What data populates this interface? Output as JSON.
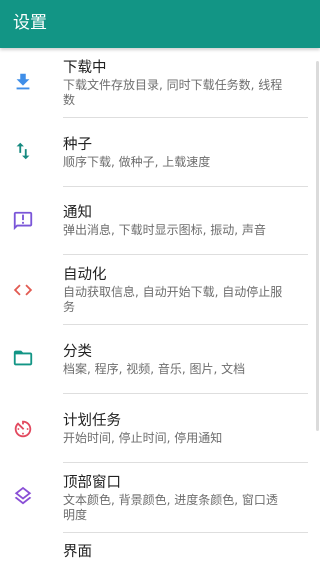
{
  "appbar": {
    "title": "设置"
  },
  "colors": {
    "appbar": "#129585",
    "icon_download": "#3f8ee8",
    "icon_torrent": "#168a80",
    "icon_notify": "#7a55d8",
    "icon_automation": "#e25b52",
    "icon_category": "#129585",
    "icon_scheduler": "#e2495f",
    "icon_top_window": "#8a4fd6"
  },
  "settings": {
    "items": [
      {
        "title": "下载中",
        "summary_1": "下载文件存放目录, 同时下载任务数, 线程",
        "summary_2": "数",
        "icon": "download-icon"
      },
      {
        "title": "种子",
        "summary_1": "顺序下载, 做种子, 上载速度",
        "summary_2": "",
        "icon": "swap-vertical-icon"
      },
      {
        "title": "通知",
        "summary_1": "弹出消息, 下载时显示图标, 振动, 声音",
        "summary_2": "",
        "icon": "notification-message-icon"
      },
      {
        "title": "自动化",
        "summary_1": "自动获取信息, 自动开始下载, 自动停止服",
        "summary_2": "务",
        "icon": "code-brackets-icon"
      },
      {
        "title": "分类",
        "summary_1": "档案, 程序, 视频, 音乐, 图片, 文档",
        "summary_2": "",
        "icon": "folder-icon"
      },
      {
        "title": "计划任务",
        "summary_1": "开始时间, 停止时间, 停用通知",
        "summary_2": "",
        "icon": "timer-icon"
      },
      {
        "title": "顶部窗口",
        "summary_1": "文本颜色, 背景颜色, 进度条颜色, 窗口透",
        "summary_2": "明度",
        "icon": "layers-icon"
      },
      {
        "title": "界面",
        "summary_1": "",
        "summary_2": "",
        "icon": ""
      }
    ]
  }
}
